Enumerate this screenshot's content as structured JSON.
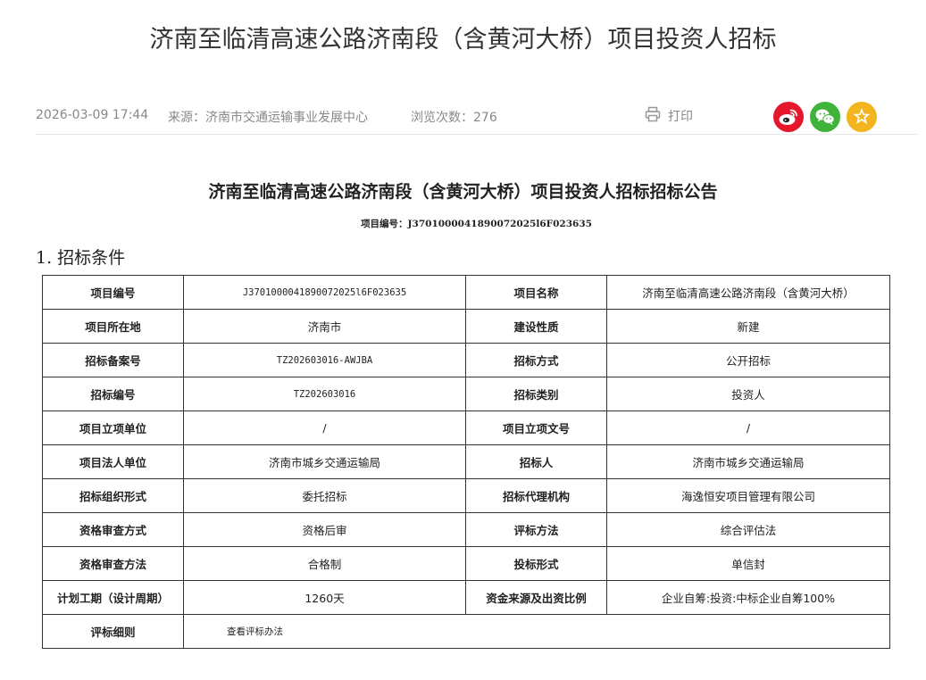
{
  "header": {
    "title": "济南至临清高速公路济南段（含黄河大桥）项目投资人招标"
  },
  "meta": {
    "date": "2026-03-09 17:44",
    "source": "来源：济南市交通运输事业发展中心",
    "views": "浏览次数：276",
    "print_label": "打印",
    "icons": {
      "print": "printer-icon",
      "weibo": "weibo-icon",
      "wechat": "wechat-icon",
      "favorite": "star-icon"
    },
    "colors": {
      "weibo": "#e6162d",
      "wechat": "#3fb33a",
      "favorite": "#f2b51d"
    }
  },
  "notice": {
    "title": "济南至临清高速公路济南段（含黄河大桥）项目投资人招标招标公告",
    "project_no": "项目编号：J3701000041890072025l6F023635",
    "section_heading": "1.  招标条件"
  },
  "table": {
    "rows": [
      [
        "项目编号",
        "J3701000041890072025l6F023635",
        "项目名称",
        "济南至临清高速公路济南段（含黄河大桥）"
      ],
      [
        "项目所在地",
        "济南市",
        "建设性质",
        "新建"
      ],
      [
        "招标备案号",
        "TZ202603016-AWJBA",
        "招标方式",
        "公开招标"
      ],
      [
        "招标编号",
        "TZ202603016",
        "招标类别",
        "投资人"
      ],
      [
        "项目立项单位",
        "/",
        "项目立项文号",
        "/"
      ],
      [
        "项目法人单位",
        "济南市城乡交通运输局",
        "招标人",
        "济南市城乡交通运输局"
      ],
      [
        "招标组织形式",
        "委托招标",
        "招标代理机构",
        "海逸恒安项目管理有限公司"
      ],
      [
        "资格审查方式",
        "资格后审",
        "评标方法",
        "综合评估法"
      ],
      [
        "资格审查方法",
        "合格制",
        "投标形式",
        "单信封"
      ],
      [
        "计划工期（设计周期）",
        "1260天",
        "资金来源及出资比例",
        "企业自筹:投资:中标企业自筹100%"
      ]
    ],
    "last_row": {
      "label": "评标细则",
      "value": "查看评标办法"
    }
  }
}
